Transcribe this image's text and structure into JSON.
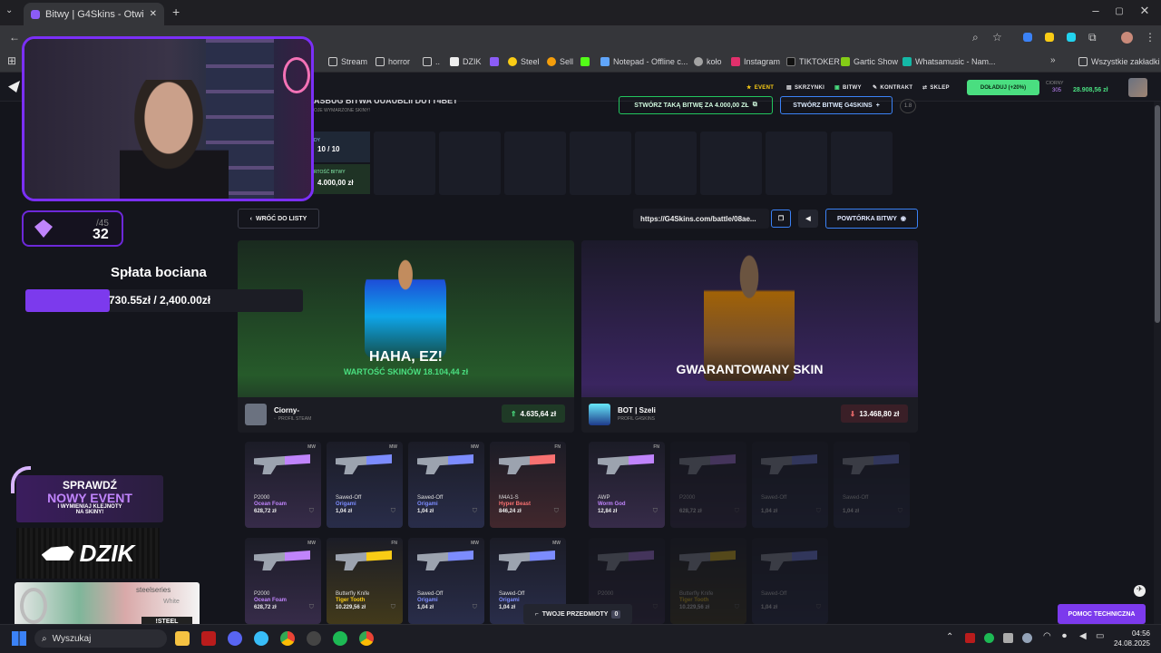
{
  "browser": {
    "tab_title": "Bitwy | G4Skins - Otwieraj skrzy",
    "bookmarks": [
      "Stream",
      "horror",
      "..",
      "DZIK",
      "",
      "Steel",
      "Sell",
      "",
      "Notepad - Offline c...",
      "koło",
      "Instagram",
      "TIKTOKER",
      "Gartic Show",
      "Whatsamusic - Nam..."
    ],
    "all_bookmarks": "Wszystkie zakładki"
  },
  "site": {
    "nav": {
      "event": "EVENT",
      "cases": "SKRZYNKI",
      "battles": "BITWY",
      "contract": "KONTRAKT",
      "shop": "SKLEP"
    },
    "deposit": "DOŁADUJ (+20%)",
    "user": {
      "name": "CIORNY",
      "level": "305",
      "balance": "28.908,56 zł"
    }
  },
  "battle": {
    "title_partial": "ASBUG BITWA UUAUBLII DUTT4BET",
    "subtitle_partial": "OJE WYMARZONE SKINY!",
    "create_same": "STWÓRZ TAKĄ BITWĘ ZA 4.000,00 ZŁ",
    "create_g4": "STWÓRZ BITWĘ G4SKINS",
    "round_label": "DY",
    "round_value": "10 / 10",
    "value_label": "RTOŚĆ BITWY",
    "value": "4.000,00 zł",
    "level_badge": "1.8",
    "back": "WRÓĆ DO LISTY",
    "url": "https://G4Skins.com/battle/08ae...",
    "replay": "POWTÓRKA BITWY",
    "my_items": "TWOJE PRZEDMIOTY",
    "my_items_count": "0",
    "help": "POMOC TECHNICZNA"
  },
  "players": [
    {
      "banner": "HAHA, EZ!",
      "banner_sub": "WARTOŚĆ SKINÓW 18.104,44 zł",
      "name": "Ciorny-",
      "profile": "PROFIL STEAM",
      "amount": "4.635,64 zł",
      "items": [
        {
          "wear": "MW",
          "name": "P2000",
          "skin": "Ocean Foam",
          "price": "628,72 zł",
          "color": "#c084fc"
        },
        {
          "wear": "MW",
          "name": "Sawed-Off",
          "skin": "Origami",
          "price": "1,04 zł",
          "color": "#7c8cff"
        },
        {
          "wear": "MW",
          "name": "Sawed-Off",
          "skin": "Origami",
          "price": "1,04 zł",
          "color": "#7c8cff"
        },
        {
          "wear": "FN",
          "name": "M4A1-S",
          "skin": "Hyper Beast",
          "price": "846,24 zł",
          "color": "#f87171"
        },
        {
          "wear": "MW",
          "name": "P2000",
          "skin": "Ocean Foam",
          "price": "628,72 zł",
          "color": "#c084fc"
        },
        {
          "wear": "FN",
          "name": "Butterfly Knife",
          "skin": "Tiger Tooth",
          "price": "10.229,56 zł",
          "color": "#facc15"
        },
        {
          "wear": "MW",
          "name": "Sawed-Off",
          "skin": "Origami",
          "price": "1,04 zł",
          "color": "#7c8cff"
        },
        {
          "wear": "MW",
          "name": "Sawed-Off",
          "skin": "Origami",
          "price": "1,04 zł",
          "color": "#7c8cff"
        }
      ]
    },
    {
      "banner": "GWARANTOWANY SKIN",
      "name": "BOT | Szeli",
      "profile": "PROFIL G4SKINS",
      "amount": "13.468,80 zł",
      "items": [
        {
          "wear": "FN",
          "name": "AWP",
          "skin": "Worm God",
          "price": "12,84 zł",
          "color": "#c084fc"
        },
        {
          "wear": "",
          "name": "P2000",
          "skin": "",
          "price": "628,72 zł",
          "color": "#c084fc"
        },
        {
          "wear": "",
          "name": "Sawed-Off",
          "skin": "",
          "price": "1,04 zł",
          "color": "#7c8cff"
        },
        {
          "wear": "",
          "name": "Sawed-Off",
          "skin": "",
          "price": "1,04 zł",
          "color": "#7c8cff"
        },
        {
          "wear": "",
          "name": "P2000",
          "skin": "",
          "price": "628,72 zł",
          "color": "#c084fc"
        },
        {
          "wear": "",
          "name": "Butterfly Knife",
          "skin": "Tiger Tooth",
          "price": "10.229,56 zł",
          "color": "#facc15"
        },
        {
          "wear": "",
          "name": "Sawed-Off",
          "skin": "",
          "price": "1,04 zł",
          "color": "#7c8cff"
        }
      ]
    }
  ],
  "overlay": {
    "counter_total": "/45",
    "counter_value": "32",
    "goal_title": "Spłata bociana",
    "goal_text": "730.55zł / 2,400.00zł",
    "goal_fraction": 0.304,
    "event_line1": "SPRAWDŹ",
    "event_line2": "NOWY EVENT",
    "event_line3": "I WYMIENIAJ KLEJNOTY",
    "event_line4": "NA SKINY!",
    "dzik": "DZIK",
    "steelseries": "steelseries",
    "steel_cmd": "!STEEL",
    "steel_white": "White"
  },
  "taskbar": {
    "search": "Wyszukaj",
    "time": "04:56",
    "date": "24.08.2025"
  }
}
